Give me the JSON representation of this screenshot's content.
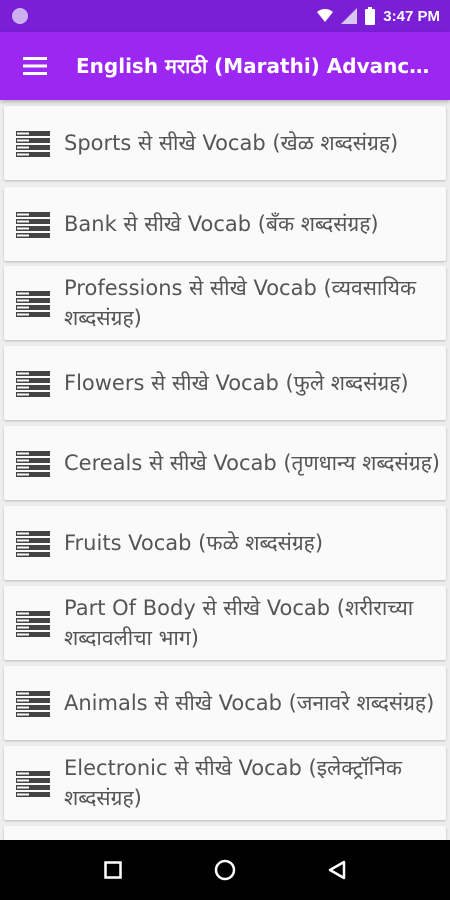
{
  "status_bar": {
    "time": "3:47 PM",
    "icons": [
      "notification-dot-icon",
      "wifi-icon",
      "cellular-signal-icon",
      "battery-icon"
    ]
  },
  "app_bar": {
    "title": "English मराठी (Marathi) Advanced Vocab",
    "menu_icon": "hamburger-menu-icon"
  },
  "items": [
    {
      "label": "Sports से सीखे Vocab (खेळ शब्दसंग्रह)",
      "icon": "list-icon"
    },
    {
      "label": "Bank से सीखे Vocab (बँक शब्दसंग्रह)",
      "icon": "list-icon"
    },
    {
      "label": "Professions से सीखे Vocab (व्यवसायिक शब्दसंग्रह)",
      "icon": "list-icon"
    },
    {
      "label": "Flowers से सीखे Vocab (फुले शब्दसंग्रह)",
      "icon": "list-icon"
    },
    {
      "label": "Cereals से सीखे Vocab (तृणधान्य शब्दसंग्रह)",
      "icon": "list-icon"
    },
    {
      "label": "Fruits Vocab (फळे शब्दसंग्रह)",
      "icon": "list-icon"
    },
    {
      "label": "Part Of Body से सीखे Vocab (शरीराच्या शब्दावलीचा भाग)",
      "icon": "list-icon"
    },
    {
      "label": "Animals से सीखे Vocab (जनावरे शब्दसंग्रह)",
      "icon": "list-icon"
    },
    {
      "label": "Electronic से सीखे Vocab (इलेक्ट्रॉनिक शब्दसंग्रह)",
      "icon": "list-icon"
    }
  ],
  "nav_bar": {
    "buttons": [
      "recents-square-icon",
      "home-circle-icon",
      "back-triangle-icon"
    ]
  },
  "colors": {
    "status_bar": "#7a1fd6",
    "app_bar": "#9c27f2",
    "card": "#fafafa",
    "background": "#eeeeee",
    "text": "#555555",
    "icon": "#444444"
  }
}
